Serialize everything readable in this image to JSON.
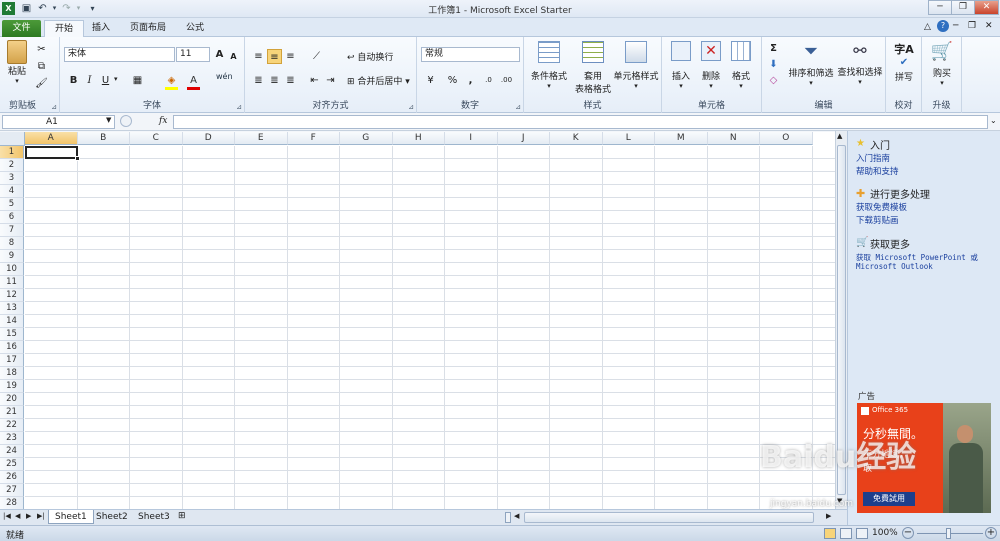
{
  "window": {
    "title": "工作簿1 - Microsoft Excel Starter"
  },
  "tabs": {
    "file": "文件",
    "home": "开始",
    "insert": "插入",
    "page_layout": "页面布局",
    "formulas": "公式"
  },
  "ribbon": {
    "clipboard": {
      "paste": "粘贴",
      "label": "剪贴板"
    },
    "font": {
      "name": "宋体",
      "size": "11",
      "label": "字体",
      "bold": "B",
      "italic": "I",
      "underline": "U",
      "grow": "A",
      "shrink": "A",
      "phonetic": "wén"
    },
    "alignment": {
      "wrap": "自动换行",
      "merge": "合并后居中",
      "label": "对齐方式"
    },
    "number": {
      "format": "常规",
      "percent": "%",
      "comma": ",",
      "label": "数字"
    },
    "styles": {
      "conditional": "条件格式",
      "table_1": "套用",
      "table_2": "表格格式",
      "cell_styles": "单元格样式",
      "label": "样式"
    },
    "cells": {
      "insert": "插入",
      "delete": "删除",
      "format": "格式",
      "label": "单元格"
    },
    "editing": {
      "sort": "排序和筛选",
      "find": "查找和选择",
      "label": "编辑",
      "sum": "Σ"
    },
    "proofing": {
      "spell": "拼写",
      "label": "校对",
      "icon_text": "字A"
    },
    "upgrade": {
      "buy": "购买",
      "label": "升级"
    }
  },
  "formula_bar": {
    "name_box": "A1",
    "fx": "fx",
    "value": ""
  },
  "grid": {
    "columns": [
      "A",
      "B",
      "C",
      "D",
      "E",
      "F",
      "G",
      "H",
      "I",
      "J",
      "K",
      "L",
      "M",
      "N",
      "O"
    ],
    "rows": [
      "1",
      "2",
      "3",
      "4",
      "5",
      "6",
      "7",
      "8",
      "9",
      "10",
      "11",
      "12",
      "13",
      "14",
      "15",
      "16",
      "17",
      "18",
      "19",
      "20",
      "21",
      "22",
      "23",
      "24",
      "25",
      "26",
      "27",
      "28"
    ],
    "selected": "A1"
  },
  "sheets": [
    "Sheet1",
    "Sheet2",
    "Sheet3"
  ],
  "status": {
    "ready": "就绪",
    "zoom": "100%",
    "minus": "−",
    "plus": "+"
  },
  "pane": {
    "getting_started": {
      "heading": "入门",
      "links": [
        "入门指南",
        "帮助和支持"
      ]
    },
    "do_more": {
      "heading": "进行更多处理",
      "links": [
        "获取免费模板",
        "下载剪贴画"
      ]
    },
    "get_more": {
      "heading": "获取更多",
      "link_1": "获取 Microsoft PowerPoint 或",
      "link_2": "Microsoft Outlook"
    },
    "ad": {
      "label": "广告",
      "brand": "Office 365",
      "headline": "分秒無間。",
      "line": "不分地域，",
      "line_2": "取",
      "button": "免費試用"
    }
  },
  "watermark": {
    "text": "Baidu经验",
    "url": "jingyan.baidu.com"
  },
  "colors": {
    "file_tab": "#2d7a22",
    "ad_bg": "#e8411a",
    "accent": "#1a3f9e",
    "header_sel": "#f7d47a"
  }
}
